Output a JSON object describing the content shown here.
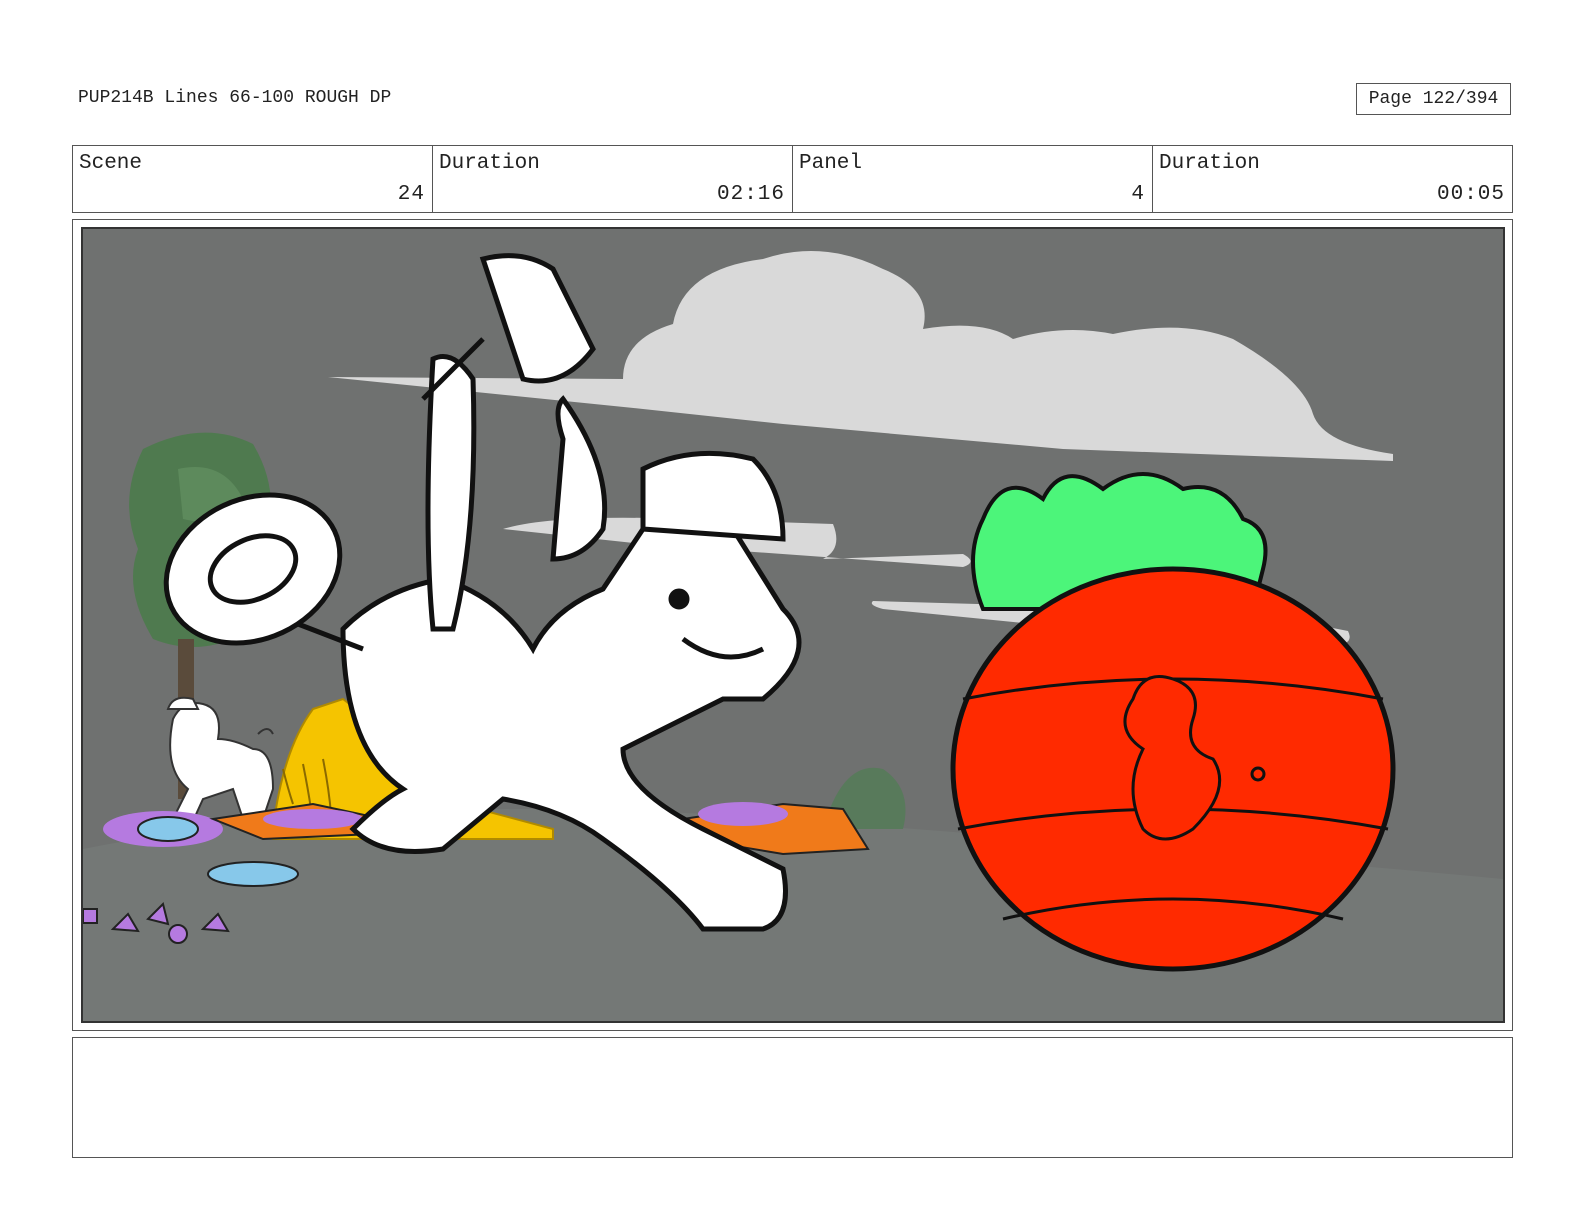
{
  "header": {
    "title": "PUP214B Lines 66-100 ROUGH DP",
    "page": "Page 122/394"
  },
  "info": {
    "scene_label": "Scene",
    "scene_value": "24",
    "scene_duration_label": "Duration",
    "scene_duration_value": "02:16",
    "panel_label": "Panel",
    "panel_value": "4",
    "panel_duration_label": "Duration",
    "panel_duration_value": "00:05"
  },
  "panel_art": {
    "colors": {
      "background": "#6f7170",
      "ground": "#707472",
      "cloud": "#d9d9d9",
      "apple": "#ff2a00",
      "leaves": "#4cf57a",
      "crystal": "#b57ae0",
      "ice": "#87c8ea",
      "debris": "#f07a1a",
      "yellow": "#f5c400",
      "tree": "#4f7a4f"
    }
  },
  "notes": ""
}
